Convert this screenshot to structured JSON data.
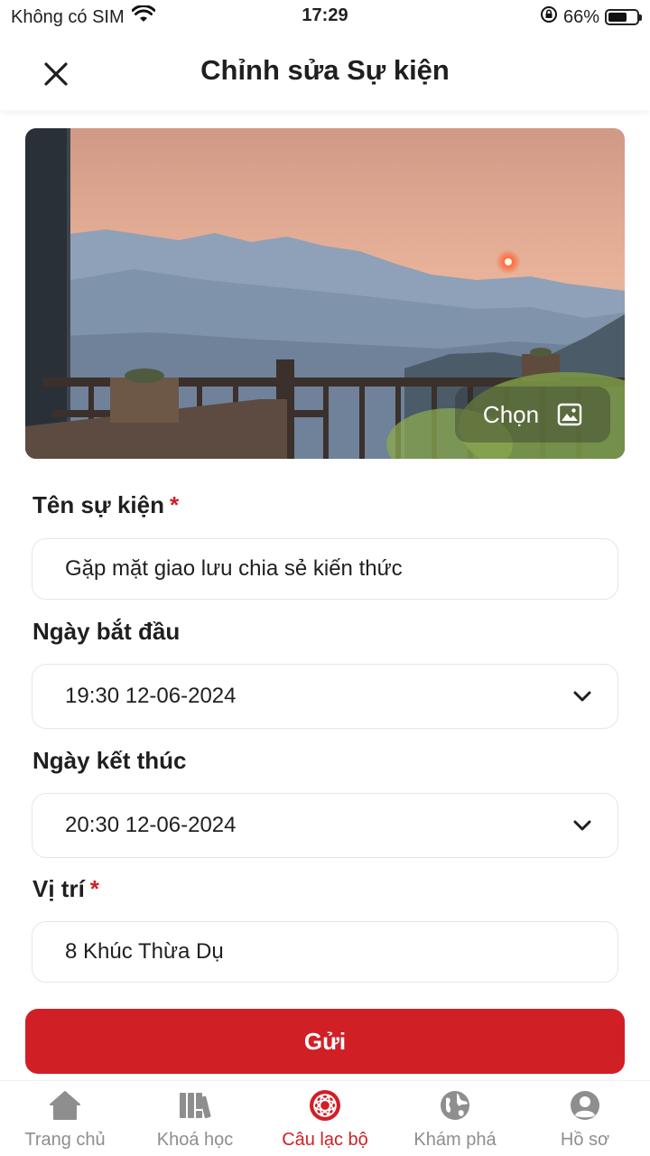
{
  "status_bar": {
    "carrier": "Không có SIM",
    "time": "17:29",
    "battery_percent": "66%",
    "battery_level": 0.66
  },
  "header": {
    "title": "Chỉnh sửa Sự kiện",
    "close_icon": "close-icon"
  },
  "cover": {
    "choose_label": "Chọn",
    "choose_icon": "image-icon"
  },
  "form": {
    "event_name": {
      "label": "Tên sự kiện",
      "required_mark": "*",
      "value": "Gặp mặt giao lưu chia sẻ kiến thức"
    },
    "start_date": {
      "label": "Ngày bắt đầu",
      "value": "19:30 12-06-2024"
    },
    "end_date": {
      "label": "Ngày kết thúc",
      "value": "20:30 12-06-2024"
    },
    "location": {
      "label": "Vị trí",
      "required_mark": "*",
      "value": "8 Khúc Thừa Dụ"
    }
  },
  "submit_label": "Gửi",
  "tabs": [
    {
      "label": "Trang chủ",
      "icon": "home-icon"
    },
    {
      "label": "Khoá học",
      "icon": "books-icon"
    },
    {
      "label": "Câu lạc bộ",
      "icon": "club-icon",
      "active": true
    },
    {
      "label": "Khám phá",
      "icon": "globe-icon"
    },
    {
      "label": "Hồ sơ",
      "icon": "profile-icon"
    }
  ],
  "colors": {
    "accent": "#d11f26",
    "inactive_tab": "#8e8e8e",
    "border": "#e6e6e6"
  }
}
